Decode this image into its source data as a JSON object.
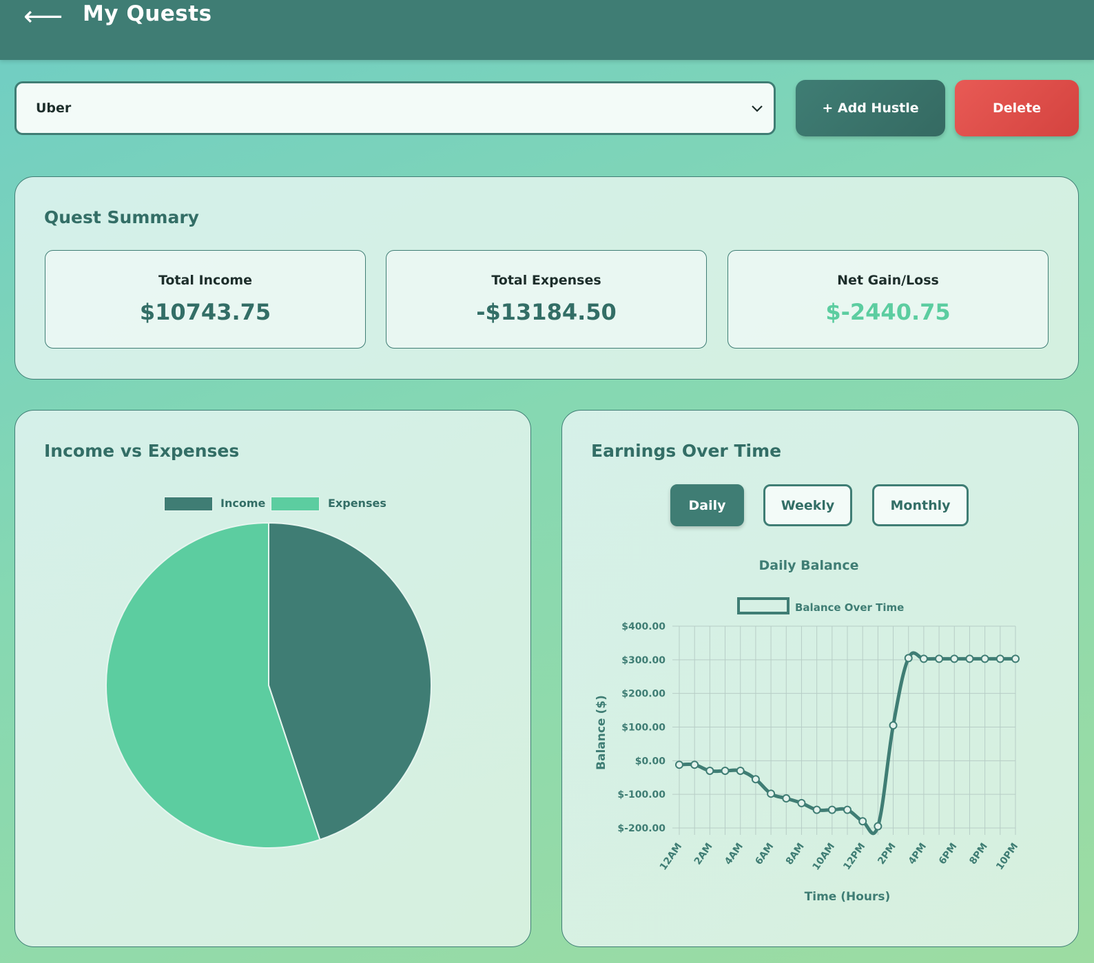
{
  "header": {
    "back_icon": "arrow-left-icon",
    "back_glyph": "⟵",
    "title": "My Quests"
  },
  "hustle": {
    "selected": "Uber",
    "add_label": "+ Add Hustle",
    "delete_label": "Delete"
  },
  "summary": {
    "title": "Quest Summary",
    "cards": [
      {
        "label": "Total Income",
        "value": "$10743.75",
        "color": "#336e66"
      },
      {
        "label": "Total Expenses",
        "value": "-$13184.50",
        "color": "#336e66"
      },
      {
        "label": "Net Gain/Loss",
        "value": "$-2440.75",
        "color": "#5ccda0"
      }
    ]
  },
  "colors": {
    "accent": "#3f7d74",
    "income": "#3f7d74",
    "expenses": "#5ccda0",
    "danger": "#e85a55"
  },
  "pie": {
    "title": "Income vs Expenses",
    "chart_data": {
      "type": "pie",
      "labels": [
        "Income",
        "Expenses"
      ],
      "values": [
        10743.75,
        13184.5
      ],
      "colors": [
        "#3f7d74",
        "#5ccda0"
      ],
      "legend": "top"
    }
  },
  "earnings": {
    "title": "Earnings Over Time",
    "tabs": [
      {
        "label": "Daily",
        "active": true
      },
      {
        "label": "Weekly",
        "active": false
      },
      {
        "label": "Monthly",
        "active": false
      }
    ],
    "chart_data": {
      "type": "line",
      "title": "Daily Balance",
      "series_name": "Balance Over Time",
      "xlabel": "Time (Hours)",
      "ylabel": "Balance ($)",
      "ylim": [
        -200,
        400
      ],
      "yticks": [
        "$400.00",
        "$300.00",
        "$200.00",
        "$100.00",
        "$0.00",
        "$-100.00",
        "$-200.00"
      ],
      "xtick_labels": [
        "12AM",
        "2AM",
        "4AM",
        "6AM",
        "8AM",
        "10AM",
        "12PM",
        "2PM",
        "4PM",
        "6PM",
        "8PM",
        "10PM"
      ],
      "x": [
        0,
        1,
        2,
        3,
        4,
        5,
        6,
        7,
        8,
        9,
        10,
        11,
        12,
        13,
        14,
        15,
        16,
        17,
        18,
        19,
        20,
        21,
        22
      ],
      "values": [
        -12,
        -12,
        -30,
        -30,
        -30,
        -55,
        -98,
        -112,
        -126,
        -146,
        -146,
        -146,
        -180,
        -195,
        105,
        305,
        303,
        303,
        303,
        303,
        303,
        303,
        303
      ],
      "grid": true,
      "legend": "top"
    }
  }
}
